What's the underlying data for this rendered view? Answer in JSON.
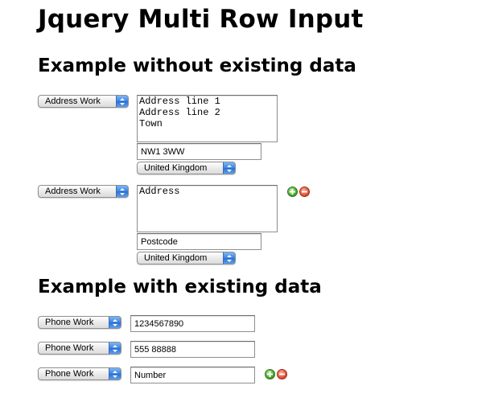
{
  "title": "Jquery Multi Row Input",
  "section1": {
    "heading": "Example without existing data",
    "rows": [
      {
        "type": "Address Work",
        "address_value": "Address line 1\nAddress line 2\nTown",
        "address_placeholder": "Address",
        "postcode_value": "NW1 3WW",
        "postcode_placeholder": "Postcode",
        "country": "United Kingdom"
      },
      {
        "type": "Address Work",
        "address_value": "Address",
        "address_placeholder": "Address",
        "postcode_value": "Postcode",
        "postcode_placeholder": "Postcode",
        "country": "United Kingdom"
      }
    ]
  },
  "section2": {
    "heading": "Example with existing data",
    "rows": [
      {
        "type": "Phone Work",
        "value": "1234567890",
        "placeholder": "Number"
      },
      {
        "type": "Phone Work",
        "value": "555 88888",
        "placeholder": "Number"
      },
      {
        "type": "Phone Work",
        "value": "Number",
        "placeholder": "Number"
      }
    ]
  },
  "icons": {
    "add": "add-row-icon",
    "remove": "remove-row-icon"
  },
  "colors": {
    "add": "#4aa62c",
    "remove": "#e0533b",
    "select_arrow": "#3b82e0"
  }
}
